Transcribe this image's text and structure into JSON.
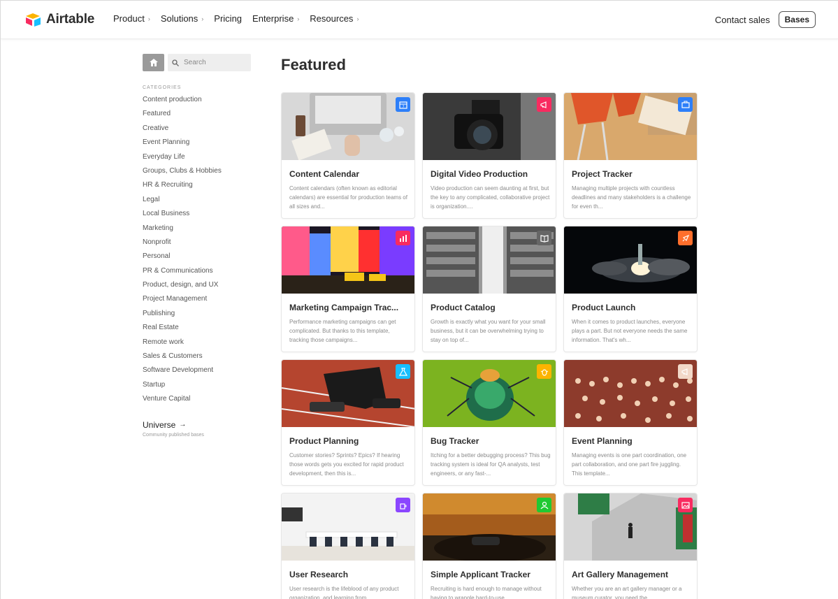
{
  "nav": {
    "brand": "Airtable",
    "links": [
      {
        "label": "Product",
        "chevron": true
      },
      {
        "label": "Solutions",
        "chevron": true
      },
      {
        "label": "Pricing",
        "chevron": false
      },
      {
        "label": "Enterprise",
        "chevron": true
      },
      {
        "label": "Resources",
        "chevron": true
      }
    ],
    "contact": "Contact sales",
    "bases": "Bases"
  },
  "sidebar": {
    "search_placeholder": "Search",
    "categories_heading": "CATEGORIES",
    "categories": [
      "Content production",
      "Featured",
      "Creative",
      "Event Planning",
      "Everyday Life",
      "Groups, Clubs & Hobbies",
      "HR & Recruiting",
      "Legal",
      "Local Business",
      "Marketing",
      "Nonprofit",
      "Personal",
      "PR & Communications",
      "Product, design, and UX",
      "Project Management",
      "Publishing",
      "Real Estate",
      "Remote work",
      "Sales & Customers",
      "Software Development",
      "Startup",
      "Venture Capital"
    ],
    "universe": "Universe",
    "universe_sub": "Community published bases"
  },
  "main": {
    "title": "Featured",
    "cards": [
      {
        "title": "Content Calendar",
        "desc": "Content calendars (often known as editorial calendars) are essential for production teams of all sizes and...",
        "badge_color": "#2d7ff9",
        "icon": "calendar-icon",
        "scene": "desk"
      },
      {
        "title": "Digital Video Production",
        "desc": "Video production can seem daunting at first, but the key to any complicated, collaborative project is organization....",
        "badge_color": "#f82b60",
        "icon": "megaphone-icon",
        "scene": "camera"
      },
      {
        "title": "Project Tracker",
        "desc": "Managing multiple projects with countless deadlines and many stakeholders is a challenge for even th...",
        "badge_color": "#2d7ff9",
        "icon": "briefcase-icon",
        "scene": "chairs"
      },
      {
        "title": "Marketing Campaign Trac...",
        "desc": "Performance marketing campaigns can get complicated. But thanks to this template, tracking those campaigns...",
        "badge_color": "#f82b60",
        "icon": "bar-chart-icon",
        "scene": "city"
      },
      {
        "title": "Product Catalog",
        "desc": "Growth is exactly what you want for your small business, but it can be overwhelming trying to stay on top of...",
        "badge_color": "#666666",
        "icon": "book-icon",
        "scene": "archive"
      },
      {
        "title": "Product Launch",
        "desc": "When it comes to product launches, everyone plays a part. But not everyone needs the same information. That's wh...",
        "badge_color": "#ff6f2c",
        "icon": "rocket-icon",
        "scene": "launch"
      },
      {
        "title": "Product Planning",
        "desc": "Customer stories? Sprints? Epics? If hearing those words gets you excited for rapid product development, then this is...",
        "badge_color": "#18bfff",
        "icon": "flask-icon",
        "scene": "track"
      },
      {
        "title": "Bug Tracker",
        "desc": "Itching for a better debugging process? This bug tracking system is ideal for QA analysts, test engineers, or any fast-...",
        "badge_color": "#fcb400",
        "icon": "bug-icon",
        "scene": "bug"
      },
      {
        "title": "Event Planning",
        "desc": "Managing events is one part coordination, one part collaboration, and one part fire juggling. This template...",
        "badge_color": "#f2d8c8",
        "icon": "megaphone-icon",
        "scene": "crowd"
      },
      {
        "title": "User Research",
        "desc": "User research is the lifeblood of any product organization, and learning from...",
        "badge_color": "#8b46ff",
        "icon": "coffee-icon",
        "scene": "room"
      },
      {
        "title": "Simple Applicant Tracker",
        "desc": "Recruiting is hard enough to manage without having to wrangle hard-to-use...",
        "badge_color": "#20c933",
        "icon": "person-icon",
        "scene": "sunset"
      },
      {
        "title": "Art Gallery Management",
        "desc": "Whether you are an art gallery manager or a museum curator, you need the...",
        "badge_color": "#f82b60",
        "icon": "picture-icon",
        "scene": "gallery"
      }
    ]
  }
}
